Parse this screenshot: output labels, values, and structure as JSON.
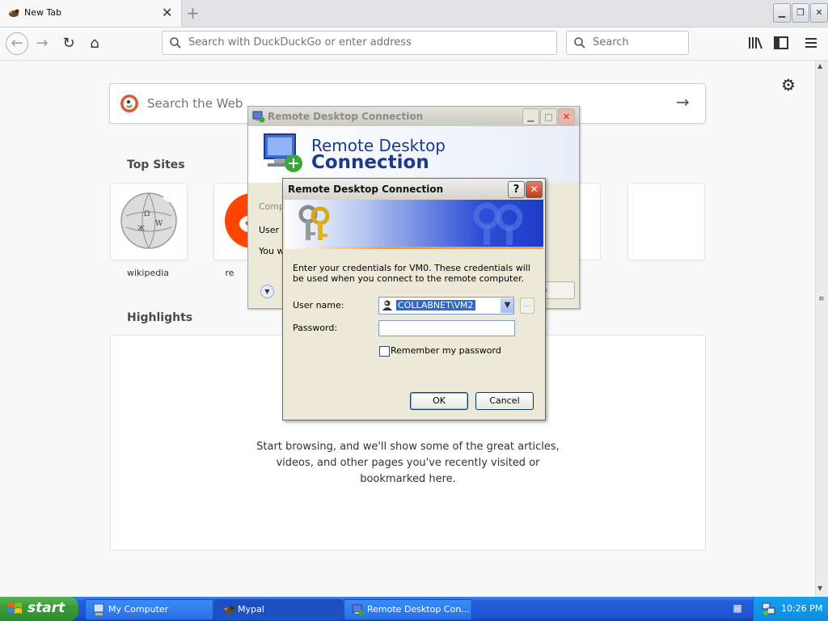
{
  "browser": {
    "tab_title": "New Tab",
    "tab_close": "✕",
    "new_tab": "+",
    "urlbar_placeholder": "Search with DuckDuckGo or enter address",
    "searchbar_placeholder": "Search"
  },
  "newtab": {
    "web_search_placeholder": "Search the Web",
    "top_sites_title": "Top Sites",
    "top_sites": [
      {
        "label": "wikipedia"
      },
      {
        "label": "re"
      }
    ],
    "highlights_title": "Highlights",
    "highlights_message": "Start browsing, and we'll show some of the great articles, videos, and other pages you've recently visited or bookmarked here."
  },
  "rdc_window": {
    "title": "Remote Desktop Connection",
    "banner_line1": "Remote Desktop",
    "banner_line2": "Connection",
    "partial_computer": "Compu",
    "partial_user": "User n",
    "partial_you": "You w",
    "partial_help": "p"
  },
  "credentials_dialog": {
    "title": "Remote Desktop Connection",
    "help_button": "?",
    "description": "Enter your credentials for VM0. These credentials will be used when you connect to the remote computer.",
    "username_label": "User name:",
    "username_value": "COLLABNET\\VM2",
    "browse_button": "...",
    "password_label": "Password:",
    "password_value": "",
    "remember_label": "Remember my password",
    "ok_label": "OK",
    "cancel_label": "Cancel"
  },
  "taskbar": {
    "start_label": "start",
    "tasks": [
      {
        "label": "My Computer"
      },
      {
        "label": "Mypal"
      },
      {
        "label": "Remote Desktop Con..."
      }
    ],
    "clock": "10:26 PM"
  },
  "colors": {
    "xp_taskbar": "#245edb",
    "xp_start": "#3a9a3a",
    "dialog_face": "#ece9d8",
    "selection": "#316ac5"
  }
}
